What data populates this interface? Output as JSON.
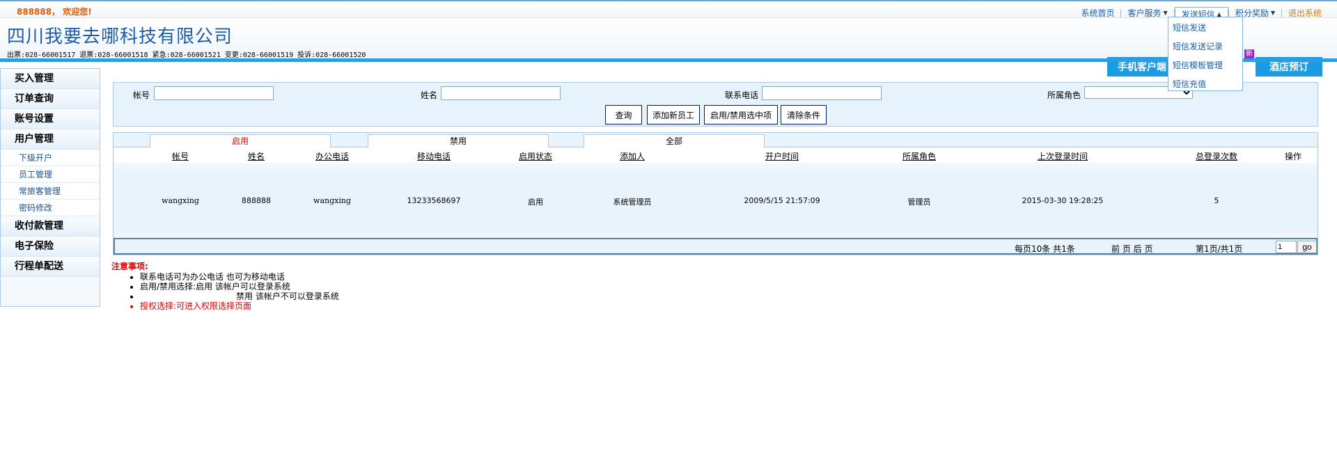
{
  "topbar": {
    "welcome": "888888， 欢迎您!",
    "nav": {
      "home": "系统首页",
      "customer_service": "客户服务",
      "send_sms": "发送短信",
      "points_reward": "积分奖励",
      "logout": "退出系统"
    },
    "sms_menu": [
      "短信发送",
      "短信发送记录",
      "短信模板管理",
      "短信充值"
    ]
  },
  "header": {
    "company": "四川我要去哪科技有限公司",
    "hotlines": "出票:028-66001517 退票:028-66001518 紧急:028-66001521  变更:028-66001519 投诉:028-66001520",
    "mobile_client_btn": "手机客户端",
    "hotel_btn": "酒店预订",
    "new_badge": "新"
  },
  "sidebar": {
    "buy": "买入管理",
    "orders": "订单查询",
    "account": "账号设置",
    "users": "用户管理",
    "sub_items": [
      "下级开户",
      "员工管理",
      "常旅客管理",
      "密码修改"
    ],
    "payments": "收付款管理",
    "insurance": "电子保险",
    "itinerary": "行程单配送"
  },
  "search": {
    "account_label": "帐号",
    "name_label": "姓名",
    "phone_label": "联系电话",
    "role_label": "所属角色",
    "account_value": "",
    "name_value": "",
    "phone_value": "",
    "role_value": "",
    "query_btn": "查询",
    "add_btn": "添加新员工",
    "toggle_btn": "启用/禁用选中项",
    "clear_btn": "清除条件"
  },
  "tabs": [
    "启用",
    "禁用",
    "全部"
  ],
  "columns": [
    "帐号",
    "姓名",
    "办公电话",
    "移动电话",
    "启用状态",
    "添加人",
    "开户时间",
    "所属角色",
    "上次登录时间",
    "总登录次数",
    "操作"
  ],
  "rows": [
    [
      "wangxing",
      "888888",
      "wangxing",
      "13233568697",
      "启用",
      "系统管理员",
      "2009/5/15 21:57:09",
      "管理员",
      "2015-03-30 19:28:25",
      "5",
      ""
    ]
  ],
  "pager": {
    "per_page": "每页10条 共1条",
    "prev_next": "前 页 后 页",
    "page_info": "第1页/共1页",
    "page_value": "1",
    "go": "go"
  },
  "notes": {
    "title": "注意事项:",
    "items": [
      "联系电话可为办公电话 也可为移动电话",
      "启用/禁用选择:启用 该帐户可以登录系统",
      "禁用 该帐户不可以登录系统",
      "授权选择:可进入权限选择页面"
    ]
  },
  "colors": {
    "accent": "#1a9be6",
    "link": "#1a5ea6",
    "warn": "#e00000"
  }
}
